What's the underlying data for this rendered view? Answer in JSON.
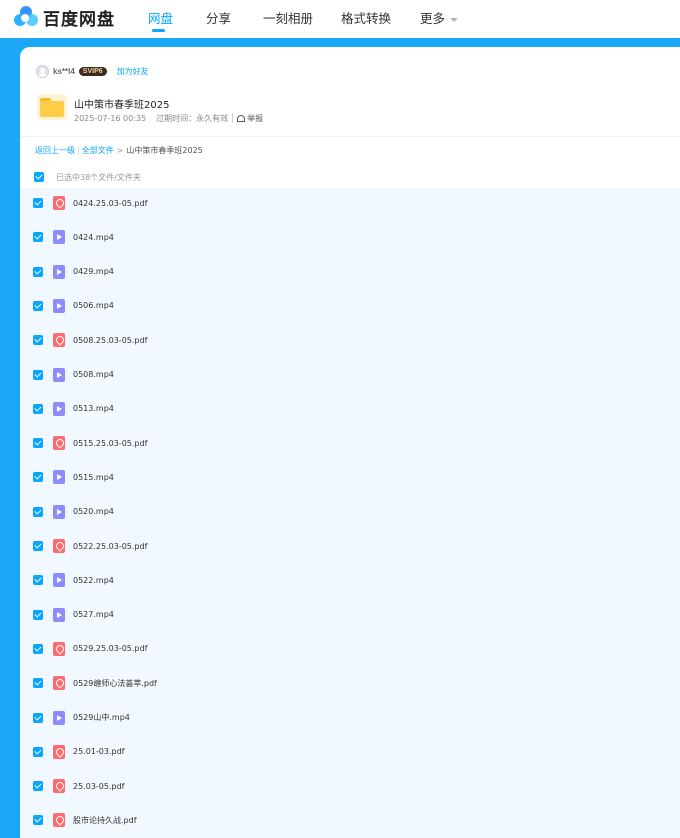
{
  "brand": {
    "name": "百度网盘"
  },
  "nav": {
    "items": [
      {
        "label": "网盘",
        "active": true
      },
      {
        "label": "分享",
        "active": false
      },
      {
        "label": "一刻相册",
        "active": false
      },
      {
        "label": "格式转换",
        "active": false
      },
      {
        "label": "更多",
        "active": false,
        "has_dropdown": true
      }
    ]
  },
  "sharer": {
    "username": "ks**l4",
    "badge": "SVIP6",
    "add_friend_label": "加为好友"
  },
  "share": {
    "title": "山中策市春季班2025",
    "date": "2025-07-16 00:35",
    "expire_label": "过期时间：永久有效",
    "report_label": "举报"
  },
  "breadcrumb": {
    "back_label": "返回上一级",
    "all_files_label": "全部文件",
    "separator": ">",
    "current": "山中策市春季班2025"
  },
  "selection": {
    "summary": "已选中38个文件/文件夹"
  },
  "files": [
    {
      "name": "0424.25.03-05.pdf",
      "type": "pdf",
      "icon": "pdf-icon"
    },
    {
      "name": "0424.mp4",
      "type": "mp4",
      "icon": "video-icon"
    },
    {
      "name": "0429.mp4",
      "type": "mp4",
      "icon": "video-icon"
    },
    {
      "name": "0506.mp4",
      "type": "mp4",
      "icon": "video-icon"
    },
    {
      "name": "0508.25.03-05.pdf",
      "type": "pdf",
      "icon": "pdf-icon"
    },
    {
      "name": "0508.mp4",
      "type": "mp4",
      "icon": "video-icon"
    },
    {
      "name": "0513.mp4",
      "type": "mp4",
      "icon": "video-icon"
    },
    {
      "name": "0515.25.03-05.pdf",
      "type": "pdf",
      "icon": "pdf-icon"
    },
    {
      "name": "0515.mp4",
      "type": "mp4",
      "icon": "video-icon"
    },
    {
      "name": "0520.mp4",
      "type": "mp4",
      "icon": "video-icon"
    },
    {
      "name": "0522.25.03-05.pdf",
      "type": "pdf",
      "icon": "pdf-icon"
    },
    {
      "name": "0522.mp4",
      "type": "mp4",
      "icon": "video-icon"
    },
    {
      "name": "0527.mp4",
      "type": "mp4",
      "icon": "video-icon"
    },
    {
      "name": "0529.25.03-05.pdf",
      "type": "pdf",
      "icon": "pdf-icon"
    },
    {
      "name": "0529缠师心法荟萃.pdf",
      "type": "pdf",
      "icon": "pdf-icon"
    },
    {
      "name": "0529山中.mp4",
      "type": "mp4",
      "icon": "video-icon"
    },
    {
      "name": "25.01-03.pdf",
      "type": "pdf",
      "icon": "pdf-icon"
    },
    {
      "name": "25.03-05.pdf",
      "type": "pdf",
      "icon": "pdf-icon"
    },
    {
      "name": "股市论持久战.pdf",
      "type": "pdf",
      "icon": "pdf-icon"
    }
  ],
  "colors": {
    "accent": "#06a7ff",
    "frame": "#1aa7f5",
    "list_bg": "#f1f8ff",
    "pdf": "#ff6b6b",
    "video": "#8c8cff",
    "folder": "#ffcd45"
  }
}
